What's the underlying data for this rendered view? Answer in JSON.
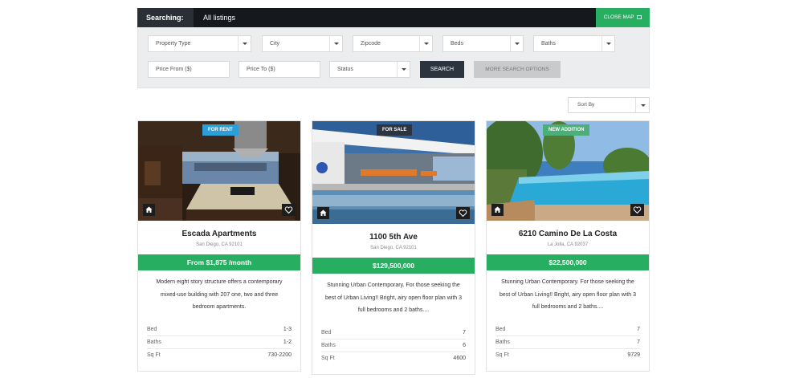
{
  "search": {
    "label": "Searching:",
    "scope": "All listings",
    "close_map": "CLOSE MAP",
    "fields": {
      "property_type": "Property Type",
      "city": "City",
      "zipcode": "Zipcode",
      "beds": "Beds",
      "baths": "Baths",
      "price_from": "Price From ($)",
      "price_to": "Price To ($)",
      "status": "Status"
    },
    "search_button": "SEARCH",
    "more_options_button": "MORE SEARCH OPTIONS",
    "sort_by": "Sort By"
  },
  "labels": {
    "bed": "Bed",
    "baths": "Baths",
    "sqft": "Sq Ft"
  },
  "colors": {
    "accent_green": "#27ae60",
    "dark_bar": "#15181c",
    "search_button": "#2c3440"
  },
  "listings": [
    {
      "badge": "FOR RENT",
      "badge_color": "#2d9fd8",
      "title": "Escada Apartments",
      "address": "San Diego, CA 92101",
      "price": "From $1,875 /month",
      "description": "Modern eight story structure offers a contemporary mixed-use building with 207 one, two and three bedroom apartments.",
      "bed": "1-3",
      "baths": "1-2",
      "sqft": "730-2200",
      "home_icon": "home-icon",
      "favorite_icon": "heart-icon"
    },
    {
      "badge": "FOR SALE",
      "badge_color": "#2c3440",
      "title": "1100 5th Ave",
      "address": "San Diego, CA 92101",
      "price": "$129,500,000",
      "description": "Stunning Urban Contemporary. For those seeking the best of Urban Living!! Bright, airy open floor plan with 3 full bedrooms and 2 baths....",
      "bed": "7",
      "baths": "6",
      "sqft": "4600",
      "home_icon": "home-icon",
      "favorite_icon": "heart-icon"
    },
    {
      "badge": "NEW ADDITION",
      "badge_color": "#4caf7a",
      "title": "6210 Camino De La Costa",
      "address": "La Jolla, CA 92037",
      "price": "$22,500,000",
      "description": "Stunning Urban Contemporary. For those seeking the best of Urban Living!! Bright, airy open floor plan with 3 full bedrooms and 2 baths....",
      "bed": "7",
      "baths": "7",
      "sqft": "9729",
      "home_icon": "home-icon",
      "favorite_icon": "heart-icon"
    }
  ]
}
